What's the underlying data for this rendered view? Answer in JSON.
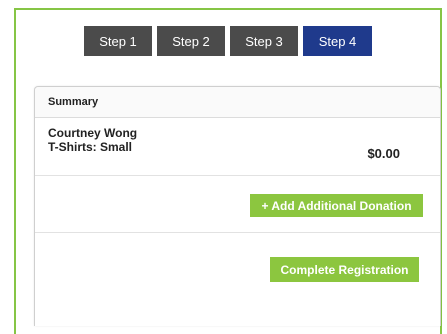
{
  "steps": [
    {
      "label": "Step 1",
      "active": false
    },
    {
      "label": "Step 2",
      "active": false
    },
    {
      "label": "Step 3",
      "active": false
    },
    {
      "label": "Step 4",
      "active": true
    }
  ],
  "summary": {
    "title": "Summary",
    "item": {
      "name": "Courtney Wong",
      "detail": "T-Shirts: Small",
      "amount": "$0.00"
    },
    "add_donation_label": "+ Add Additional Donation",
    "complete_label": "Complete Registration"
  },
  "colors": {
    "frame_border": "#86c545",
    "step_inactive": "#4b4b4b",
    "step_active": "#1f3a8c",
    "button_green": "#8cc63f"
  }
}
